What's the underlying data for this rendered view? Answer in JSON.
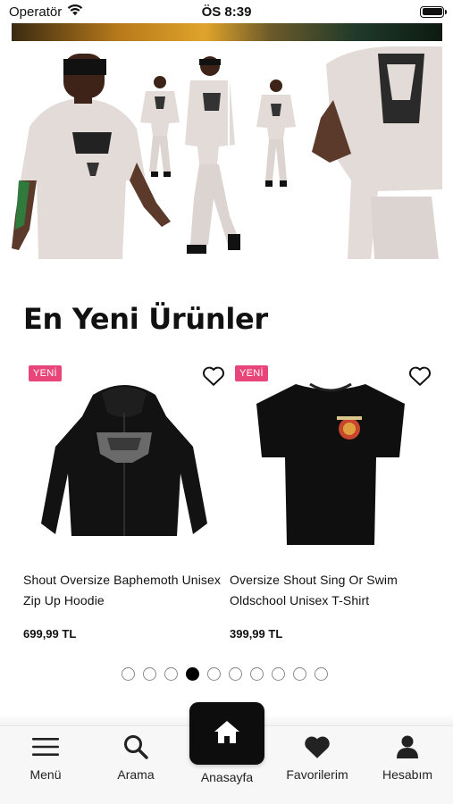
{
  "status_bar": {
    "carrier": "Operatör",
    "time": "ÖS 8:39"
  },
  "section": {
    "title": "En Yeni Ürünler"
  },
  "products": [
    {
      "badge": "YENİ",
      "name": "Shout Oversize Baphemoth Unisex Zip Up Hoodie",
      "price": "699,99 TL"
    },
    {
      "badge": "YENİ",
      "name": "Oversize Shout Sing Or Swim Oldschool Unisex T-Shirt",
      "price": "399,99 TL"
    }
  ],
  "pagination": {
    "total": 10,
    "active_index": 3
  },
  "tab_bar": {
    "menu": "Menü",
    "search": "Arama",
    "home": "Anasayfa",
    "favorites": "Favorilerim",
    "account": "Hesabım"
  },
  "colors": {
    "badge": "#e8457a",
    "home_button": "#0d0d0d",
    "tab_bar_bg": "#f7f7f7"
  },
  "icons": {
    "wifi": "wifi-icon",
    "battery": "battery-icon",
    "heart_outline": "heart-outline-icon",
    "menu": "hamburger-menu-icon",
    "search": "search-icon",
    "home": "home-icon",
    "heart_filled": "heart-filled-icon",
    "account": "user-icon"
  }
}
